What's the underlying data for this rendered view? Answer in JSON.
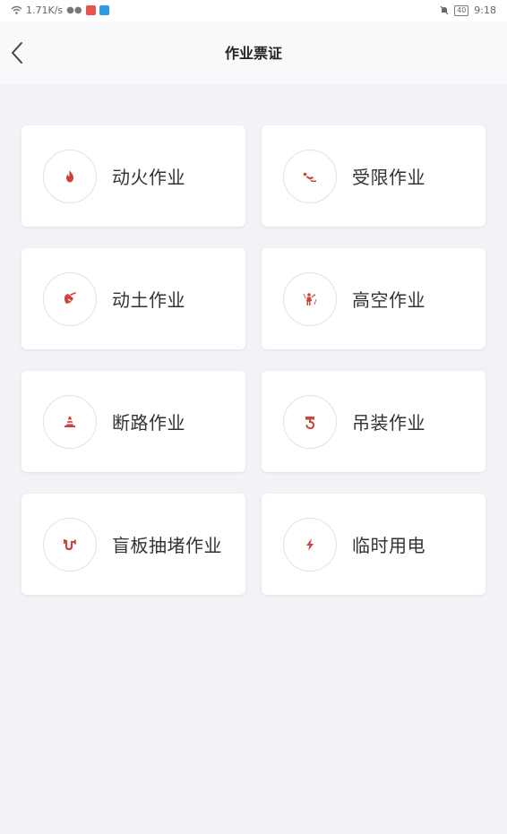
{
  "status_bar": {
    "speed": "1.71K/s",
    "battery": "40",
    "time": "9:18"
  },
  "header": {
    "title": "作业票证"
  },
  "accent_color": "#d0413c",
  "cards": [
    {
      "label": "动火作业",
      "icon": "flame-icon"
    },
    {
      "label": "受限作业",
      "icon": "crawling-person-icon"
    },
    {
      "label": "动土作业",
      "icon": "digging-icon"
    },
    {
      "label": "高空作业",
      "icon": "climbing-worker-icon"
    },
    {
      "label": "断路作业",
      "icon": "traffic-cone-icon"
    },
    {
      "label": "吊装作业",
      "icon": "crane-hook-icon"
    },
    {
      "label": "盲板抽堵作业",
      "icon": "pipe-icon"
    },
    {
      "label": "临时用电",
      "icon": "lightning-icon"
    }
  ]
}
